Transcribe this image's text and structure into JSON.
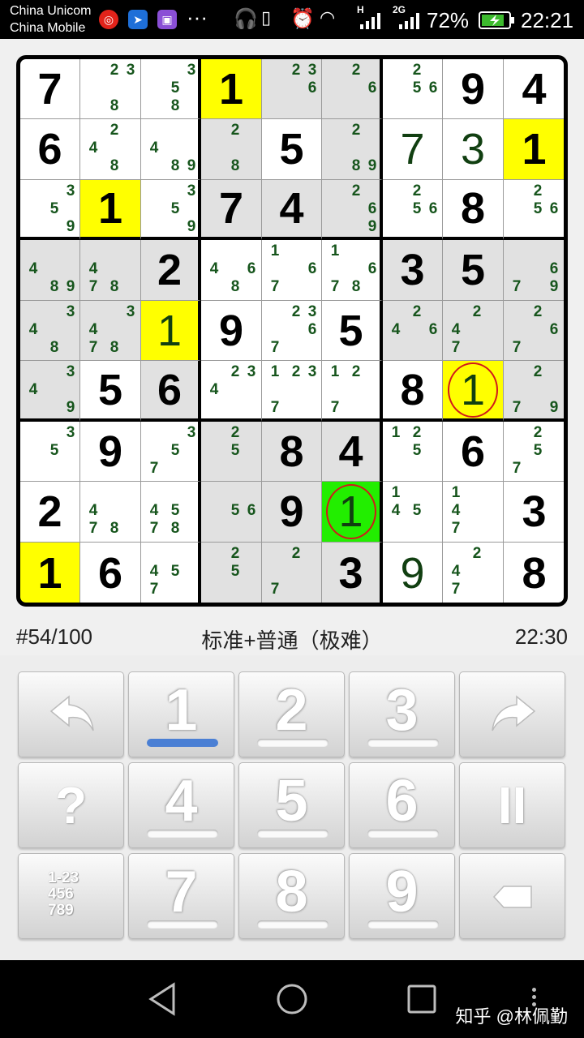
{
  "status_bar": {
    "carrier_1": "China Unicom",
    "carrier_2": "China Mobile",
    "network_1": "H",
    "network_2": "2G",
    "battery": "72%",
    "time": "22:21",
    "more": "···"
  },
  "board": {
    "grid": [
      [
        7,
        0,
        0,
        1,
        0,
        0,
        0,
        9,
        4
      ],
      [
        6,
        0,
        0,
        0,
        5,
        0,
        7,
        3,
        1
      ],
      [
        0,
        1,
        0,
        7,
        4,
        0,
        0,
        8,
        0
      ],
      [
        0,
        0,
        2,
        0,
        0,
        0,
        3,
        5,
        0
      ],
      [
        0,
        0,
        1,
        9,
        0,
        5,
        0,
        0,
        0
      ],
      [
        0,
        5,
        6,
        0,
        0,
        0,
        8,
        1,
        0
      ],
      [
        0,
        9,
        0,
        0,
        8,
        4,
        0,
        6,
        0
      ],
      [
        2,
        0,
        0,
        0,
        9,
        1,
        0,
        0,
        3
      ],
      [
        1,
        6,
        0,
        0,
        0,
        3,
        9,
        0,
        8
      ]
    ],
    "entered": [
      [
        0,
        0,
        0,
        0,
        0,
        0,
        0,
        0,
        0
      ],
      [
        0,
        0,
        0,
        0,
        0,
        0,
        1,
        1,
        0
      ],
      [
        0,
        0,
        0,
        0,
        0,
        0,
        0,
        0,
        0
      ],
      [
        0,
        0,
        0,
        0,
        0,
        0,
        0,
        0,
        0
      ],
      [
        0,
        0,
        1,
        0,
        0,
        0,
        0,
        0,
        0
      ],
      [
        0,
        0,
        0,
        0,
        0,
        0,
        0,
        1,
        0
      ],
      [
        0,
        0,
        0,
        0,
        0,
        0,
        0,
        0,
        0
      ],
      [
        0,
        0,
        0,
        0,
        0,
        1,
        0,
        0,
        0
      ],
      [
        0,
        0,
        0,
        0,
        0,
        0,
        1,
        0,
        0
      ]
    ],
    "bg": [
      "WWWYGGWWW",
      "WWWGWGWWY",
      "WYWGGGWWW",
      "GGGWWWGGG",
      "GGYWWWGGG",
      "GWGWWWWYG",
      "WWWGGGWWW",
      "WWWGGLWWW",
      "YWWGGGWWW"
    ],
    "circled": [
      [
        5,
        7
      ],
      [
        7,
        5
      ]
    ],
    "candidates": [
      [
        [],
        [
          2,
          3,
          8
        ],
        [
          3,
          5,
          8
        ],
        [],
        [
          2,
          3,
          6
        ],
        [
          2,
          6
        ],
        [
          2,
          5,
          6
        ],
        [],
        []
      ],
      [
        [],
        [
          2,
          4,
          8
        ],
        [
          4,
          8,
          9
        ],
        [
          2,
          8
        ],
        [],
        [
          2,
          8,
          9
        ],
        [],
        [],
        []
      ],
      [
        [
          3,
          5,
          9
        ],
        [],
        [
          3,
          5,
          9
        ],
        [],
        [],
        [
          2,
          6,
          9
        ],
        [
          2,
          5,
          6
        ],
        [],
        [
          2,
          5,
          6
        ]
      ],
      [
        [
          4,
          8,
          9
        ],
        [
          4,
          7,
          8
        ],
        [],
        [
          4,
          6,
          8
        ],
        [
          1,
          6,
          7
        ],
        [
          1,
          6,
          7,
          8
        ],
        [],
        [],
        [
          6,
          7,
          9
        ]
      ],
      [
        [
          3,
          4,
          8
        ],
        [
          3,
          4,
          7,
          8
        ],
        [],
        [],
        [
          2,
          3,
          6,
          7
        ],
        [],
        [
          2,
          4,
          6
        ],
        [
          2,
          4,
          7
        ],
        [
          2,
          6,
          7
        ]
      ],
      [
        [
          3,
          4,
          9
        ],
        [],
        [],
        [
          2,
          3,
          4
        ],
        [
          1,
          2,
          3,
          7
        ],
        [
          1,
          2,
          7
        ],
        [],
        [],
        [
          2,
          7,
          9
        ]
      ],
      [
        [
          3,
          5
        ],
        [],
        [
          3,
          5,
          7
        ],
        [
          2,
          5
        ],
        [],
        [],
        [
          1,
          2,
          5
        ],
        [],
        [
          2,
          5,
          7
        ]
      ],
      [
        [],
        [
          4,
          7,
          8
        ],
        [
          4,
          5,
          7,
          8
        ],
        [
          5,
          6
        ],
        [],
        [],
        [
          1,
          4,
          5
        ],
        [
          1,
          4,
          7
        ],
        []
      ],
      [
        [],
        [],
        [
          4,
          5,
          7
        ],
        [
          2,
          5
        ],
        [
          2,
          7
        ],
        [],
        [],
        [
          2,
          4,
          7
        ],
        []
      ]
    ]
  },
  "info": {
    "puzzle_index": "#54/100",
    "mode": "标准+普通（极难）",
    "timer": "22:30"
  },
  "keypad": {
    "keys": [
      "1",
      "2",
      "3",
      "4",
      "5",
      "6",
      "7",
      "8",
      "9"
    ],
    "active_key": "1",
    "undo_icon": "undo-arrow-icon",
    "redo_icon": "redo-arrow-icon",
    "hint_label": "?",
    "pause_label": "II",
    "notes_label": [
      "1-23",
      "456",
      "789"
    ],
    "erase_icon": "backspace-icon"
  },
  "watermark": "知乎 @林佩勤"
}
